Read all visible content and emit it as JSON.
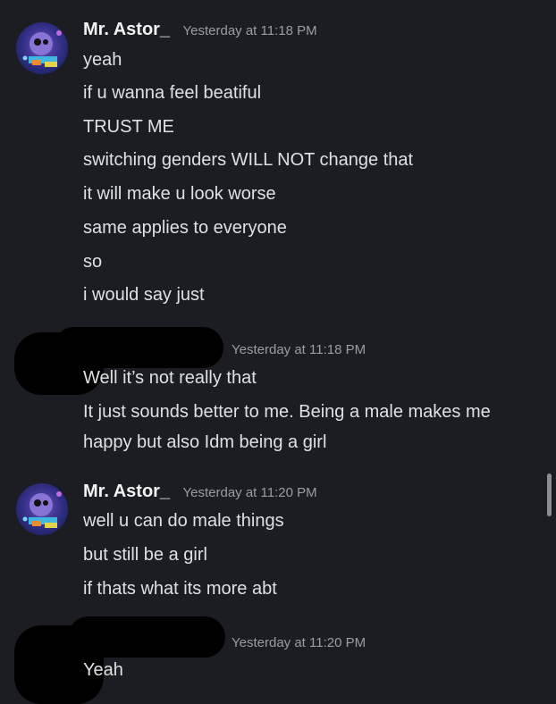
{
  "messages": [
    {
      "author": "Mr. Astor_",
      "timestamp": "Yesterday at 11:18 PM",
      "lines": [
        "yeah",
        "if u wanna feel beatiful",
        "TRUST ME",
        "switching genders WILL NOT change that",
        "it will make u look worse",
        "same applies to everyone",
        "so",
        "i would say just"
      ]
    },
    {
      "author": "",
      "timestamp": "Yesterday at 11:18 PM",
      "lines": [
        "Well it’s not really that",
        "It just sounds better to me. Being a male makes me happy but also Idm being a girl"
      ]
    },
    {
      "author": "Mr. Astor_",
      "timestamp": "Yesterday at 11:20 PM",
      "lines": [
        "well u can do male things",
        "but still be a girl",
        "if thats what its more abt"
      ]
    },
    {
      "author": "",
      "timestamp": "Yesterday at 11:20 PM",
      "lines": [
        "Yeah"
      ]
    }
  ],
  "icons": {
    "avatar": "avatar-icon"
  }
}
